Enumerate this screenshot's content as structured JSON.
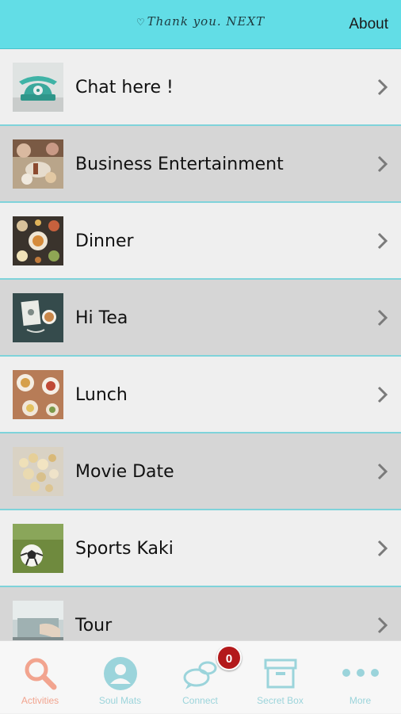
{
  "header": {
    "title": "Thank you. NEXT",
    "about_label": "About"
  },
  "list": {
    "items": [
      {
        "label": "Chat here !"
      },
      {
        "label": "Business Entertainment"
      },
      {
        "label": "Dinner"
      },
      {
        "label": "Hi Tea"
      },
      {
        "label": "Lunch"
      },
      {
        "label": "Movie Date"
      },
      {
        "label": "Sports Kaki"
      },
      {
        "label": "Tour"
      }
    ]
  },
  "tabbar": {
    "tabs": [
      {
        "label": "Activities",
        "icon": "search-icon"
      },
      {
        "label": "Soul Mats",
        "icon": "user-icon"
      },
      {
        "label": "Connect",
        "icon": "chat-icon",
        "badge": "0"
      },
      {
        "label": "Secret Box",
        "icon": "box-icon"
      },
      {
        "label": "More",
        "icon": "more-icon"
      }
    ]
  },
  "colors": {
    "header": "#62dde6",
    "row_light": "#efefef",
    "row_dark": "#d6d6d6",
    "divider": "#7fd3da",
    "active_tab": "#f2a48f",
    "inactive_tab": "#9bd4db",
    "badge": "#b3191b"
  }
}
